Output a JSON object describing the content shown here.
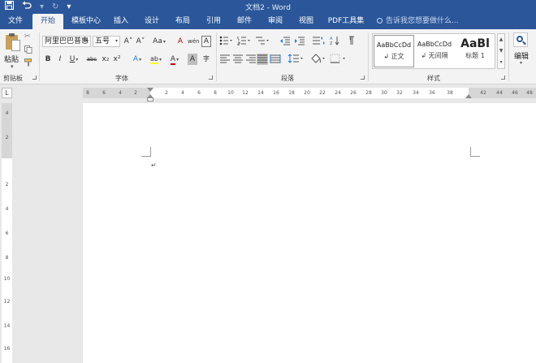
{
  "window": {
    "title": "文档2 - Word"
  },
  "quick_access": {
    "redo_glyph": "↻",
    "customize_glyph": "▾"
  },
  "tabs": [
    "文件",
    "开始",
    "模板中心",
    "插入",
    "设计",
    "布局",
    "引用",
    "邮件",
    "审阅",
    "视图",
    "PDF工具集"
  ],
  "active_tab": "开始",
  "tell_me": {
    "placeholder": "告诉我您想要做什么..."
  },
  "clipboard": {
    "paste_label": "粘贴",
    "group_label": "剪贴板"
  },
  "font": {
    "group_label": "字体",
    "font_name": "阿里巴巴普惠",
    "font_size": "五号",
    "grow": "A˄",
    "shrink": "A˅",
    "change_case": "Aa",
    "clear": "A",
    "pinyin": "wén",
    "char_border": "A",
    "bold": "B",
    "italic": "I",
    "underline": "U",
    "strikethrough": "abc",
    "subscript": "x₂",
    "superscript": "x²",
    "text_effects": "A",
    "highlight": "ab",
    "font_color": "A",
    "char_shading": "A",
    "enclose": "字"
  },
  "paragraph": {
    "group_label": "段落"
  },
  "styles": {
    "group_label": "样式",
    "items": [
      {
        "preview": "AaBbCcDd",
        "name": "↲ 正文"
      },
      {
        "preview": "AaBbCcDd",
        "name": "↲ 无间隔"
      },
      {
        "preview": "AaBl",
        "name": "标题 1"
      }
    ]
  },
  "editing": {
    "label": "编辑"
  },
  "ruler": {
    "corner": "L",
    "left_ticks": [
      "8",
      "6",
      "4",
      "2"
    ],
    "main_ticks": [
      "2",
      "4",
      "6",
      "8",
      "10",
      "12",
      "14",
      "16",
      "18",
      "20",
      "22",
      "24",
      "26",
      "28",
      "30",
      "32",
      "34",
      "36",
      "38"
    ],
    "right_ticks": [
      "42",
      "44",
      "46",
      "48"
    ],
    "vertical_top_ticks": [
      "4",
      "2"
    ],
    "vertical_ticks": [
      "2",
      "4",
      "6",
      "8",
      "10",
      "12",
      "14",
      "16"
    ]
  },
  "document": {
    "paragraph_mark": "↵"
  },
  "colors": {
    "title_bar": "#2b579a",
    "ribbon": "#f3f3f3",
    "font_color_underline": "#c00000",
    "highlight_underline": "#ffff00"
  }
}
